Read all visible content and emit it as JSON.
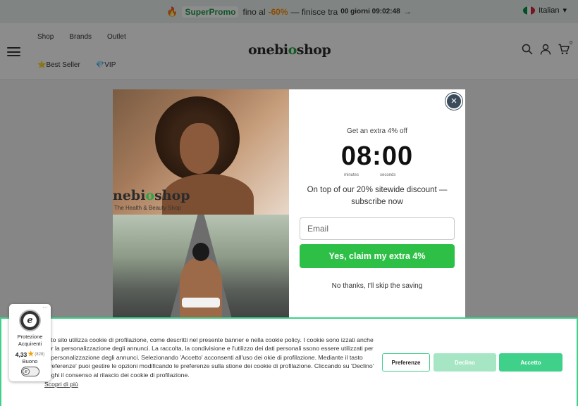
{
  "promo": {
    "fire_icon": "fire-icon",
    "name": "SuperPromo",
    "text_before": "fino al",
    "discount": "-60%",
    "text_after": "— finisce tra",
    "timer": "00 giorni 09:02:48",
    "arrow": "→"
  },
  "language": {
    "label": "Italian",
    "flag_colors": [
      "#009246",
      "#ffffff",
      "#ce2b37"
    ]
  },
  "header": {
    "logo_part1": "onebi",
    "logo_part2": "o",
    "logo_part3": "shop",
    "nav_top": [
      "Shop",
      "Brands",
      "Outlet"
    ],
    "nav_bottom": [
      "⭐Best Seller",
      "💎VIP"
    ],
    "cart_count": "0"
  },
  "page": {
    "homepage_link": "homepage"
  },
  "popup": {
    "logo_part1": "nebi",
    "logo_part2": "o",
    "logo_part3": "shop",
    "tagline": "The Health & Beauty Shop",
    "close_label": "×",
    "heading": "Get an extra 4% off",
    "countdown": "08:00",
    "label_minutes": "minutes",
    "label_seconds": "seconds",
    "description": "On top of our 20% sitewide discount — subscribe now",
    "email_placeholder": "Email",
    "claim_label": "Yes, claim my extra 4%",
    "skip_label": "No thanks, I'll skip the saving"
  },
  "cookie": {
    "text": "esto sito utilizza cookie di profilazione, come descritti nel presente banner e nella cookie policy. I cookie sono izzati anche per la personalizzazione degli annunci. La raccolta, la condivisione e l'utilizzo dei dati personali ssono essere utilizzati per la personalizzazione degli annunci. Selezionando 'Accetto' acconsenti all'uso dei okie di profilazione. Mediante il tasto 'Preferenze' puoi gestire le opzioni modificando le preferenze sulla stione dei cookie di profilazione. Cliccando su 'Declino' neghi il consenso al rilascio dei cookie di profilazione.",
    "more_link": "Scopri di più",
    "preferences_label": "Preferenze",
    "decline_label": "Declino",
    "accept_label": "Accetto",
    "accent_color": "#3fd08a"
  },
  "trust": {
    "menu": "···",
    "seal_letter": "e",
    "label": "Protezione Acquirenti",
    "score": "4,33",
    "count": "(828)",
    "quality": "Buono"
  }
}
